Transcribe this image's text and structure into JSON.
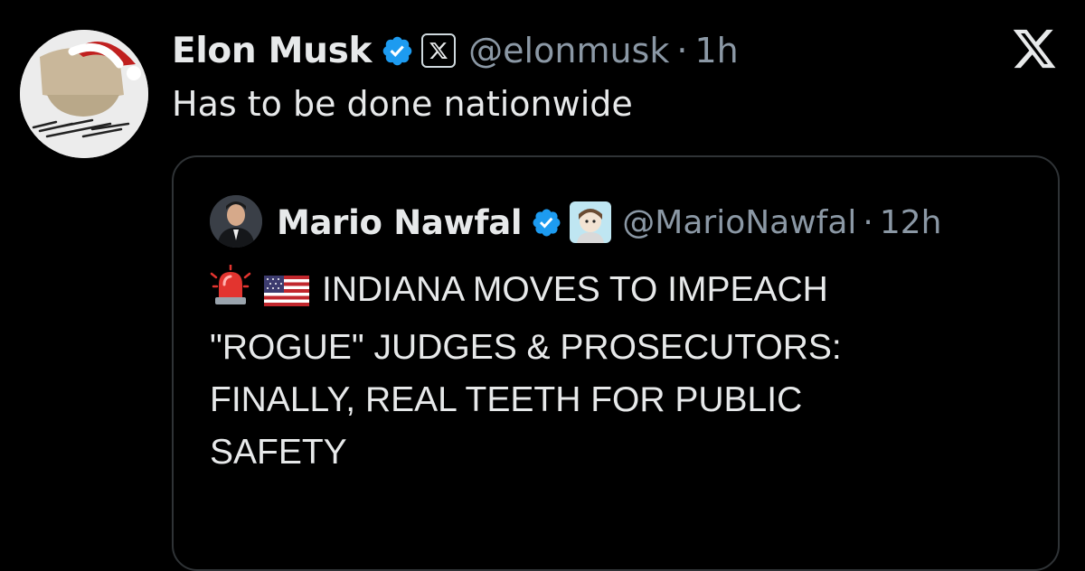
{
  "main_tweet": {
    "author_name": "Elon Musk",
    "handle": "@elonmusk",
    "separator": "·",
    "time": "1h",
    "text": "Has to be done nationwide",
    "verified_icon": "verified-badge-icon",
    "affiliate_icon": "x-affiliate-icon"
  },
  "quoted_tweet": {
    "author_name": "Mario Nawfal",
    "handle": "@MarioNawfal",
    "separator": "·",
    "time": "12h",
    "verified_icon": "verified-badge-icon",
    "affiliate_icon": "affiliate-avatar-icon",
    "emojis": [
      "rotating-light-emoji",
      "us-flag-emoji"
    ],
    "lines": [
      "INDIANA MOVES TO IMPEACH",
      "\"ROGUE\" JUDGES & PROSECUTORS:",
      "FINALLY, REAL TEETH FOR PUBLIC",
      "SAFETY"
    ]
  },
  "colors": {
    "background": "#000000",
    "text": "#e7e9ea",
    "muted": "#8b98a5",
    "verified_blue": "#1d9bf0",
    "card_border": "#2f3336"
  }
}
